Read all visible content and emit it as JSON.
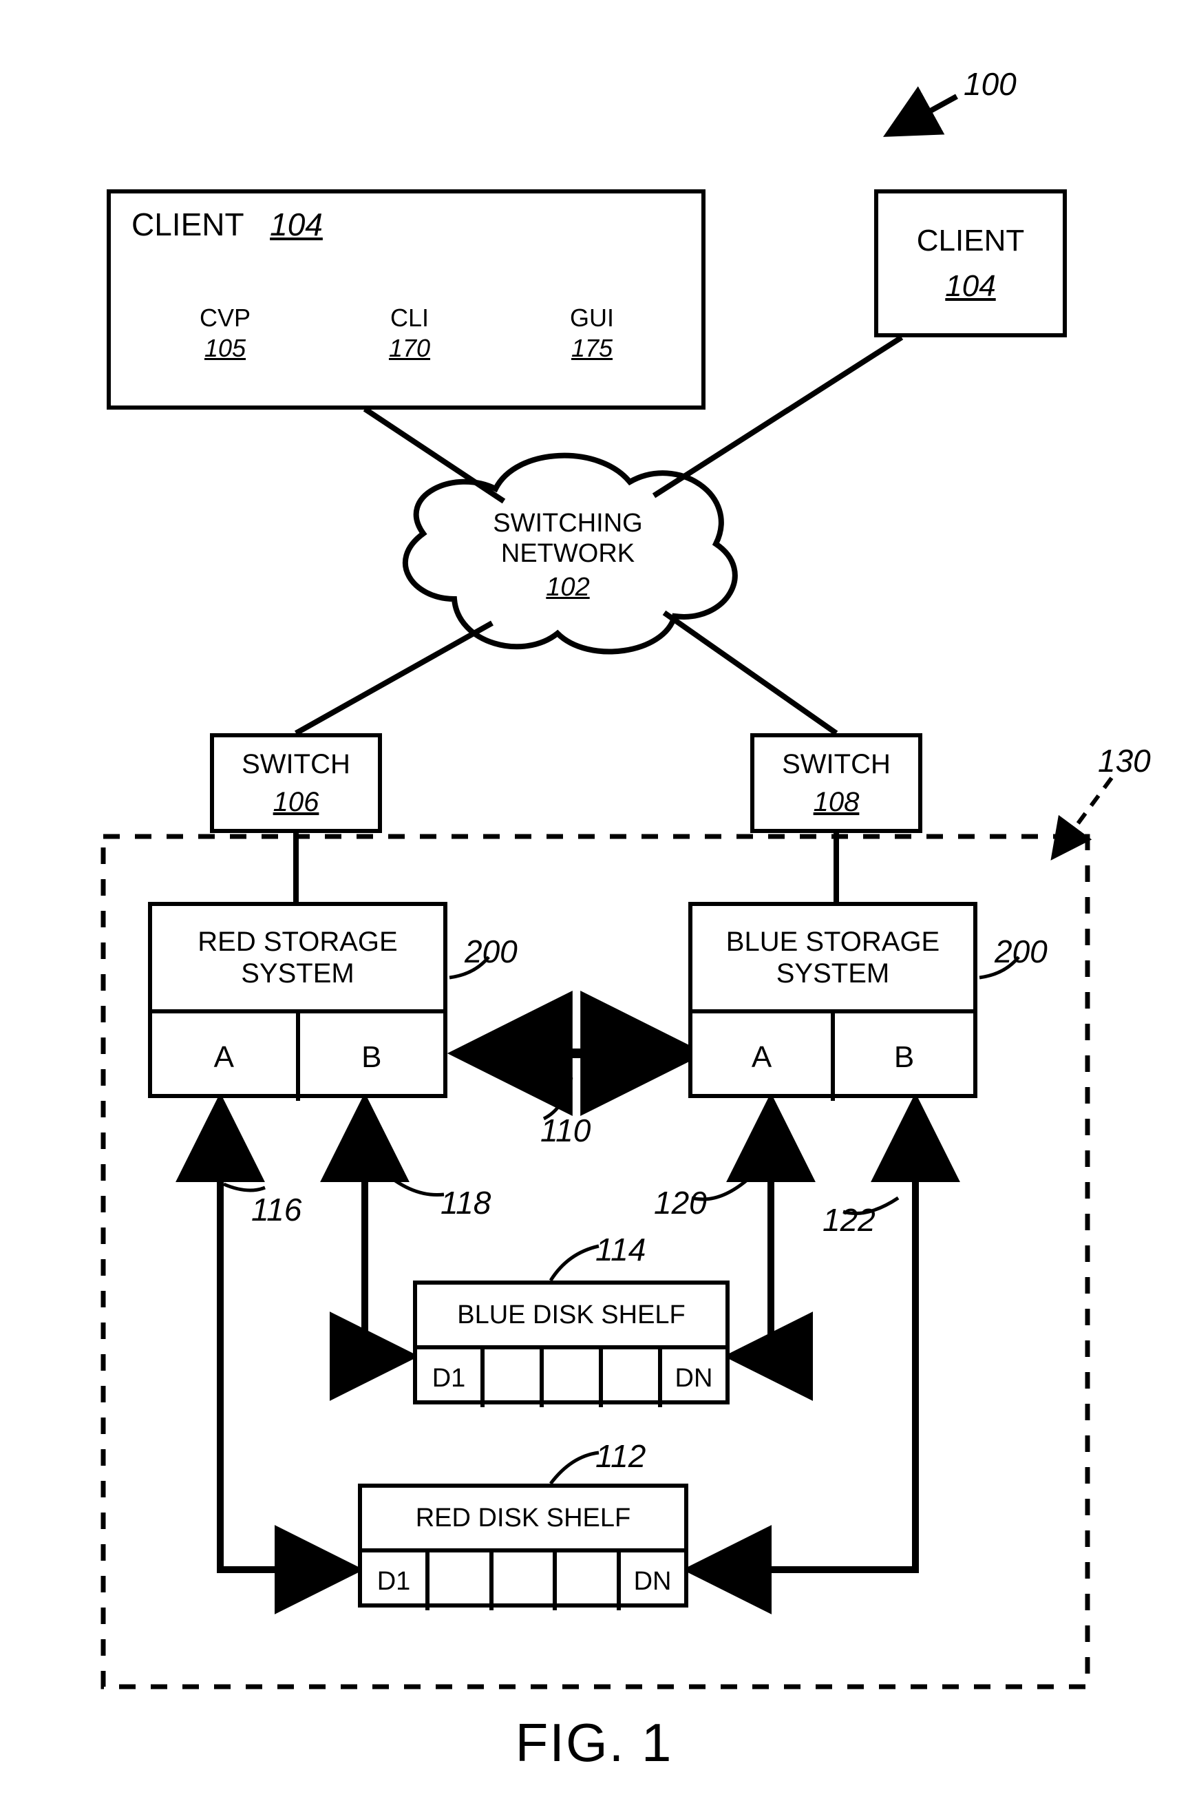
{
  "figure": {
    "caption": "FIG. 1",
    "ref_100": "100",
    "ref_130": "130"
  },
  "client1": {
    "title": "CLIENT",
    "num": "104"
  },
  "client2": {
    "title": "CLIENT",
    "num": "104"
  },
  "cvp": {
    "label": "CVP",
    "num": "105"
  },
  "cli": {
    "label": "CLI",
    "num": "170"
  },
  "gui": {
    "label": "GUI",
    "num": "175"
  },
  "network": {
    "label": "SWITCHING NETWORK",
    "num": "102"
  },
  "switch_left": {
    "label": "SWITCH",
    "num": "106"
  },
  "switch_right": {
    "label": "SWITCH",
    "num": "108"
  },
  "red_sys": {
    "title": "RED STORAGE SYSTEM",
    "a": "A",
    "b": "B",
    "num": "200"
  },
  "blue_sys": {
    "title": "BLUE STORAGE SYSTEM",
    "a": "A",
    "b": "B",
    "num": "200"
  },
  "ref_110": "110",
  "ref_116": "116",
  "ref_118": "118",
  "ref_120": "120",
  "ref_122": "122",
  "ref_114": "114",
  "ref_112": "112",
  "blue_shelf": {
    "title": "BLUE DISK SHELF",
    "d1": "D1",
    "dn": "DN"
  },
  "red_shelf": {
    "title": "RED DISK SHELF",
    "d1": "D1",
    "dn": "DN"
  }
}
